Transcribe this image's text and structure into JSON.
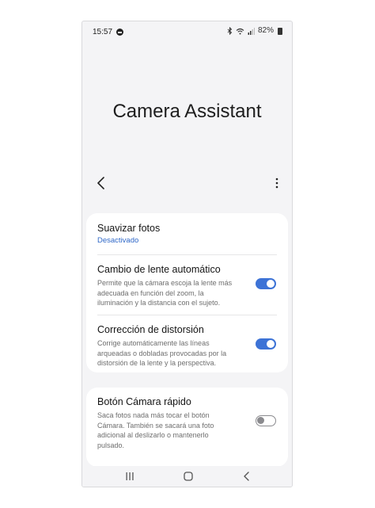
{
  "status_bar": {
    "time": "15:57",
    "battery": "82%"
  },
  "page": {
    "title": "Camera Assistant"
  },
  "settings": {
    "suavizar": {
      "title": "Suavizar fotos",
      "value": "Desactivado"
    },
    "cambio_lente": {
      "title": "Cambio de lente automático",
      "desc": "Permite que la cámara escoja la lente más adecuada en función del zoom, la iluminación y la distancia con el sujeto.",
      "enabled": true
    },
    "distorsion": {
      "title": "Corrección de distorsión",
      "desc": "Corrige automáticamente las líneas arqueadas o dobladas provocadas por la distorsión de la lente y la perspectiva.",
      "enabled": true
    },
    "boton_rapido": {
      "title": "Botón Cámara rápido",
      "desc": "Saca fotos nada más tocar el botón Cámara. También se sacará una foto adicional al deslizarlo o mantenerlo pulsado.",
      "enabled": false
    }
  },
  "icons": {
    "back": "chevron-left-icon",
    "more": "more-vertical-icon",
    "nav_recents": "recents-icon",
    "nav_home": "home-icon",
    "nav_back": "back-icon"
  },
  "colors": {
    "accent": "#3d73d6",
    "link": "#2f68c8",
    "background": "#f4f4f6"
  }
}
